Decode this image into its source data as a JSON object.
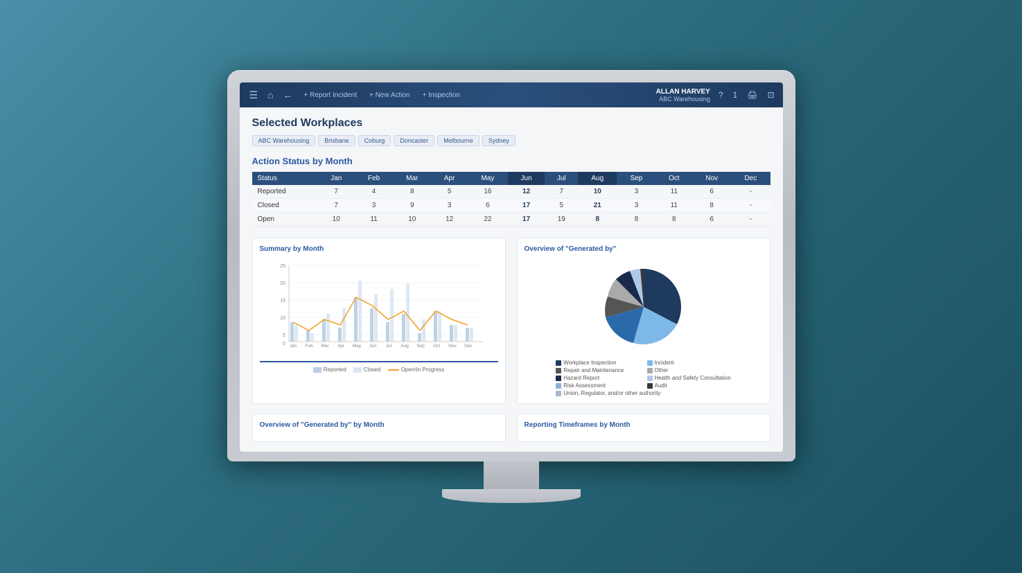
{
  "header": {
    "menu_icon": "☰",
    "home_icon": "⌂",
    "back_icon": "←",
    "report_btn": "+ Report Incident",
    "action_btn": "+ New Action",
    "inspection_btn": "+ Inspection",
    "user_name": "ALLAN HARVEY",
    "user_company": "ABC Warehousing",
    "help_icon": "?",
    "notification_icon": "1",
    "print_icon": "🖨",
    "expand_icon": "⊡"
  },
  "page": {
    "title": "Selected Workplaces",
    "tags": [
      "ABC Warehousing",
      "Brisbane",
      "Coburg",
      "Doncaster",
      "Melbourne",
      "Sydney"
    ]
  },
  "table": {
    "section_title": "Action Status by Month",
    "headers": [
      "Status",
      "Jan",
      "Feb",
      "Mar",
      "Apr",
      "May",
      "Jun",
      "Jul",
      "Aug",
      "Sep",
      "Oct",
      "Nov",
      "Dec"
    ],
    "rows": [
      {
        "status": "Reported",
        "jan": "7",
        "feb": "4",
        "mar": "8",
        "apr": "5",
        "may": "16",
        "jun": "12",
        "jul": "7",
        "aug": "10",
        "sep": "3",
        "oct": "11",
        "nov": "6",
        "dec": "-"
      },
      {
        "status": "Closed",
        "jan": "7",
        "feb": "3",
        "mar": "9",
        "apr": "3",
        "may": "6",
        "jun": "17",
        "jul": "5",
        "aug": "21",
        "sep": "3",
        "oct": "11",
        "nov": "8",
        "dec": "-"
      },
      {
        "status": "Open",
        "jan": "10",
        "feb": "11",
        "mar": "10",
        "apr": "12",
        "may": "22",
        "jun": "17",
        "jul": "19",
        "aug": "8",
        "sep": "8",
        "oct": "8",
        "nov": "6",
        "dec": "-"
      }
    ]
  },
  "summary_chart": {
    "title": "Summary by Month",
    "legend": [
      "Reported",
      "Closed",
      "Open/In Progress"
    ],
    "months": [
      "Jan",
      "Feb",
      "Mar",
      "Apr",
      "May",
      "Jun",
      "Jul",
      "Aug",
      "Sep",
      "Oct",
      "Nov",
      "Dec"
    ],
    "y_labels": [
      "0",
      "5",
      "10",
      "15",
      "20",
      "25"
    ]
  },
  "pie_chart": {
    "title": "Overview of \"Generated by\"",
    "legend": [
      {
        "label": "Workplace Inspection",
        "color": "#1e3a5f"
      },
      {
        "label": "Incident",
        "color": "#7eb8e8"
      },
      {
        "label": "Repair and Maintenance",
        "color": "#555"
      },
      {
        "label": "Other",
        "color": "#ccc"
      },
      {
        "label": "Hazard Report",
        "color": "#2a4f7c"
      },
      {
        "label": "Health and Safety Consultation",
        "color": "#b0c8e8"
      },
      {
        "label": "Risk Assessment",
        "color": "#90b0d8"
      },
      {
        "label": "Audit",
        "color": "#3a3a3a"
      },
      {
        "label": "Union, Regulator, and/or other authority",
        "color": "#a8b8c8"
      }
    ]
  },
  "bottom_charts": {
    "left_title": "Overview of \"Generated by\" by Month",
    "right_title": "Reporting Timeframes by Month"
  }
}
